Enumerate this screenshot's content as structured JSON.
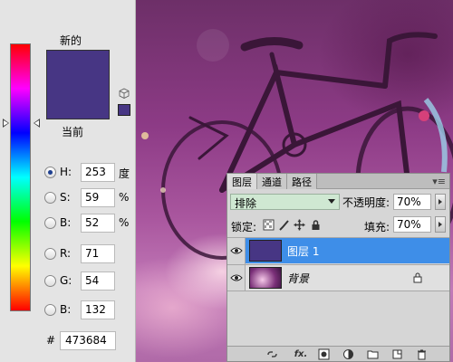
{
  "color_picker": {
    "new_label": "新的",
    "current_label": "当前",
    "new_color": "#473684",
    "current_color": "#473684",
    "hue_bar_level": 0.297,
    "fields": [
      {
        "label": "H:",
        "value": "253",
        "unit": "度",
        "checked": true
      },
      {
        "label": "S:",
        "value": "59",
        "unit": "%",
        "checked": false
      },
      {
        "label": "B:",
        "value": "52",
        "unit": "%",
        "checked": false
      },
      {
        "label": "R:",
        "value": "71",
        "unit": "",
        "checked": false
      },
      {
        "label": "G:",
        "value": "54",
        "unit": "",
        "checked": false
      },
      {
        "label": "B:",
        "value": "132",
        "unit": "",
        "checked": false
      }
    ],
    "hex_label": "#",
    "hex_value": "473684"
  },
  "layers_panel": {
    "tabs": [
      "图层",
      "通道",
      "路径"
    ],
    "active_tab": "图层",
    "menu_icon": "panel-menu-icon",
    "blend_mode": "排除",
    "opacity_label": "不透明度:",
    "opacity_value": "70%",
    "lock_label": "锁定:",
    "fill_label": "填充:",
    "fill_value": "70%",
    "layers": [
      {
        "name": "图层 1",
        "selected": true,
        "thumb_color": "#473684",
        "locked": false
      },
      {
        "name": "背景",
        "selected": false,
        "thumb_color": "#7a2f78",
        "locked": true
      }
    ],
    "bottom_icons": [
      "link-icon",
      "fx-icon",
      "mask-icon",
      "adjustment-icon",
      "group-folder-icon",
      "new-layer-icon",
      "trash-icon"
    ],
    "bottom_fx_label": "fx."
  },
  "colors": {
    "selected_layer": "#3e8ee8",
    "blend_mode_bg": "#cfe8d2"
  }
}
